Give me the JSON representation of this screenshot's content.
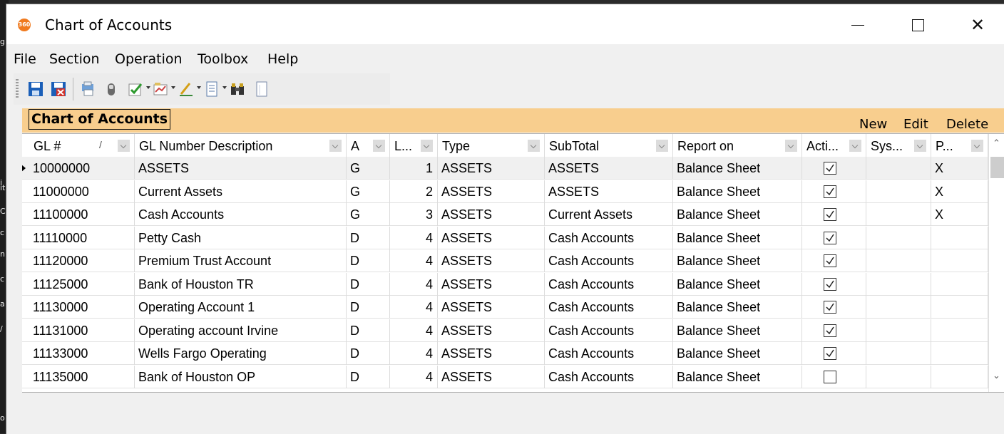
{
  "window": {
    "title": "Chart of Accounts",
    "icon_text": "360",
    "controls": {
      "minimize": "—",
      "maximize": "",
      "close": "✕"
    }
  },
  "menu": [
    "File",
    "Section",
    "Operation",
    "Toolbox",
    "Help"
  ],
  "toolbar": {
    "icons": [
      "save-icon",
      "save-close-icon",
      "print-icon",
      "mouse-icon",
      "checklist-icon",
      "chart-icon",
      "pencil-icon",
      "document-icon",
      "binoculars-icon",
      "page-icon"
    ]
  },
  "section": {
    "title": "Chart of Accounts",
    "actions": {
      "new": "New",
      "edit": "Edit",
      "delete": "Delete"
    }
  },
  "grid": {
    "columns": [
      {
        "key": "gl",
        "label": "GL #"
      },
      {
        "key": "desc",
        "label": "GL Number Description"
      },
      {
        "key": "a",
        "label": "A"
      },
      {
        "key": "l",
        "label": "L..."
      },
      {
        "key": "type",
        "label": "Type"
      },
      {
        "key": "subtotal",
        "label": "SubTotal"
      },
      {
        "key": "report",
        "label": "Report on"
      },
      {
        "key": "active",
        "label": "Acti..."
      },
      {
        "key": "sys",
        "label": "Sys..."
      },
      {
        "key": "p",
        "label": "P..."
      }
    ],
    "sort_glyph": "/",
    "rows": [
      {
        "gl": "10000000",
        "desc": "ASSETS",
        "a": "G",
        "l": "1",
        "type": "ASSETS",
        "subtotal": "ASSETS",
        "report": "Balance Sheet",
        "active": true,
        "sys": "",
        "p": "X"
      },
      {
        "gl": "11000000",
        "desc": "Current Assets",
        "a": "G",
        "l": "2",
        "type": "ASSETS",
        "subtotal": "ASSETS",
        "report": "Balance Sheet",
        "active": true,
        "sys": "",
        "p": "X"
      },
      {
        "gl": "11100000",
        "desc": "Cash Accounts",
        "a": "G",
        "l": "3",
        "type": "ASSETS",
        "subtotal": "Current Assets",
        "report": "Balance Sheet",
        "active": true,
        "sys": "",
        "p": "X"
      },
      {
        "gl": "11110000",
        "desc": "Petty Cash",
        "a": "D",
        "l": "4",
        "type": "ASSETS",
        "subtotal": "Cash Accounts",
        "report": "Balance Sheet",
        "active": true,
        "sys": "",
        "p": ""
      },
      {
        "gl": "11120000",
        "desc": "Premium Trust Account",
        "a": "D",
        "l": "4",
        "type": "ASSETS",
        "subtotal": "Cash Accounts",
        "report": "Balance Sheet",
        "active": true,
        "sys": "",
        "p": ""
      },
      {
        "gl": "11125000",
        "desc": "Bank of Houston TR",
        "a": "D",
        "l": "4",
        "type": "ASSETS",
        "subtotal": "Cash Accounts",
        "report": "Balance Sheet",
        "active": true,
        "sys": "",
        "p": ""
      },
      {
        "gl": "11130000",
        "desc": "Operating Account 1",
        "a": "D",
        "l": "4",
        "type": "ASSETS",
        "subtotal": "Cash Accounts",
        "report": "Balance Sheet",
        "active": true,
        "sys": "",
        "p": ""
      },
      {
        "gl": "11131000",
        "desc": "Operating account Irvine",
        "a": "D",
        "l": "4",
        "type": "ASSETS",
        "subtotal": "Cash Accounts",
        "report": "Balance Sheet",
        "active": true,
        "sys": "",
        "p": ""
      },
      {
        "gl": "11133000",
        "desc": "Wells Fargo Operating",
        "a": "D",
        "l": "4",
        "type": "ASSETS",
        "subtotal": "Cash Accounts",
        "report": "Balance Sheet",
        "active": true,
        "sys": "",
        "p": ""
      },
      {
        "gl": "11135000",
        "desc": "Bank of Houston OP",
        "a": "D",
        "l": "4",
        "type": "ASSETS",
        "subtotal": "Cash Accounts",
        "report": "Balance Sheet",
        "active": false,
        "sys": "",
        "p": ""
      }
    ],
    "selected_row": 0,
    "scroll": {
      "up": "⌃",
      "down": "⌄"
    }
  },
  "background_letters": [
    "g",
    "i",
    "it",
    "C",
    "c",
    "n",
    "c",
    "a",
    "/",
    "o"
  ],
  "colors": {
    "section_bar": "#f8ce8e",
    "app_icon": "#f07a1f",
    "save_blue": "#1b5fb8",
    "save_red": "#d0342c"
  }
}
